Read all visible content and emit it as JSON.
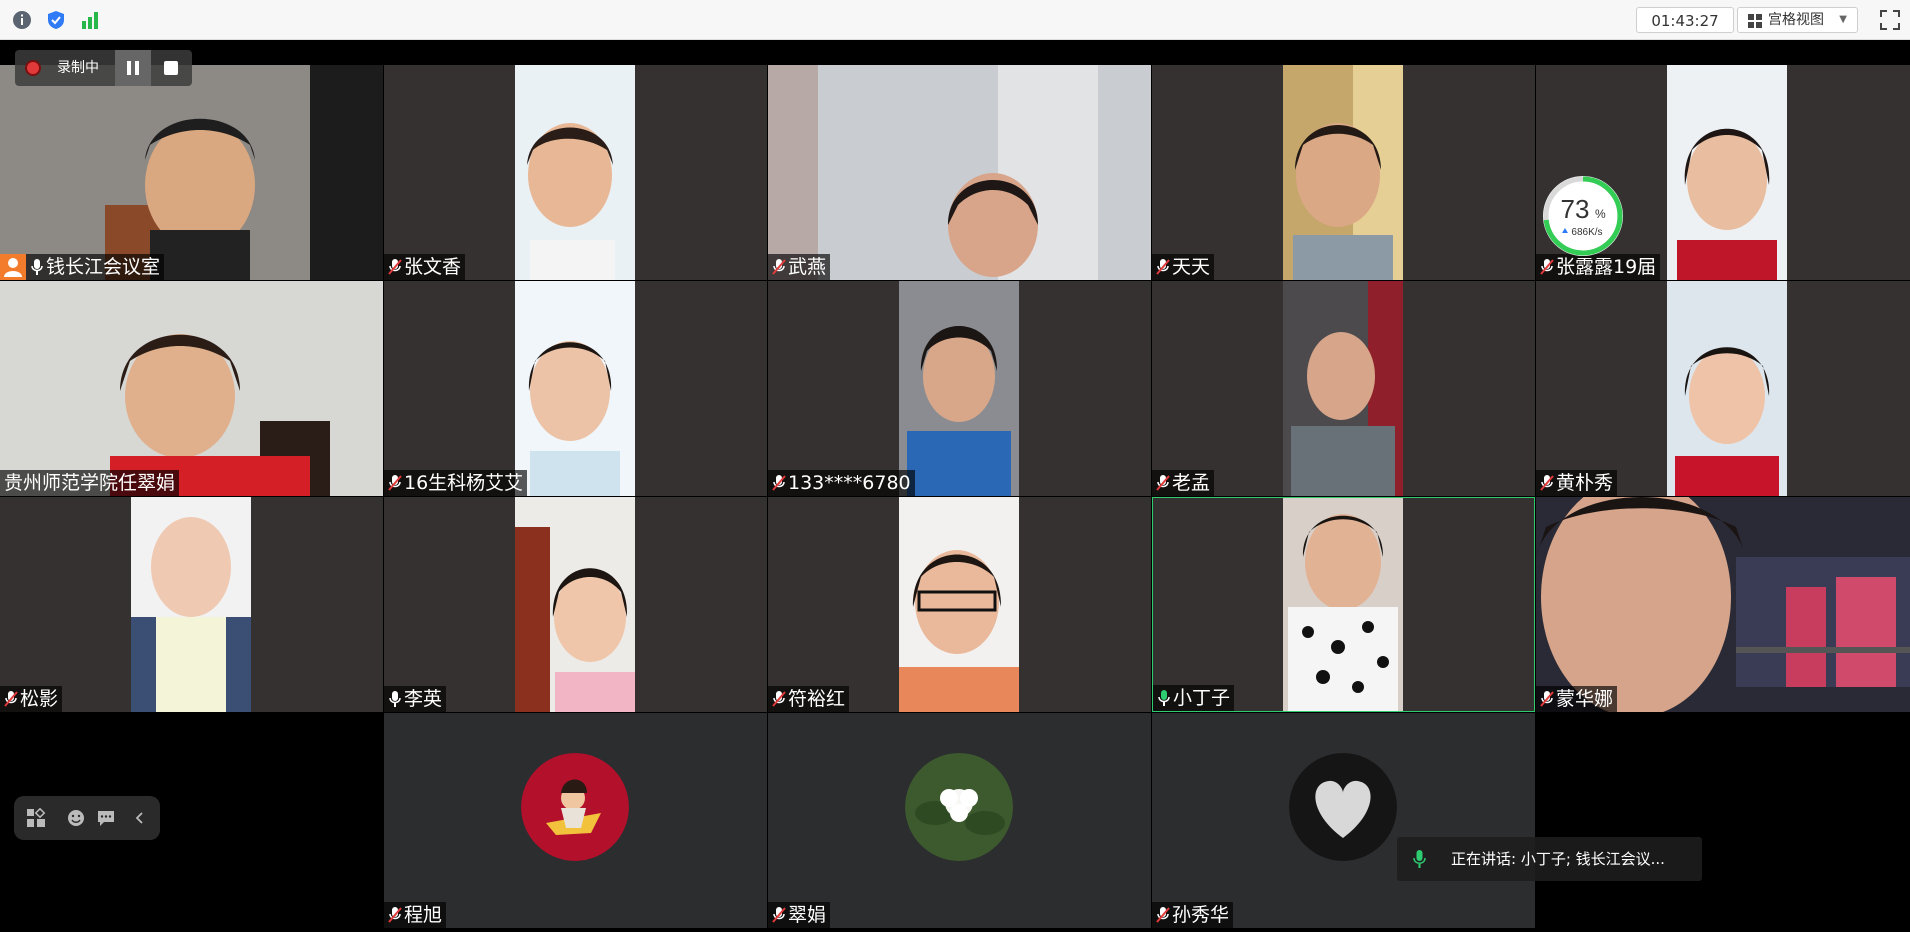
{
  "timer": "01:43:27",
  "view_mode": "宫格视图",
  "recording": {
    "label": "录制中"
  },
  "network": {
    "percent": "73",
    "unit": "%",
    "speed": "686K/s"
  },
  "speaking": "正在讲话: 小丁子; 钱长江会议...",
  "participants": [
    {
      "name": "钱长江会议室",
      "host": true,
      "mic": "on"
    },
    {
      "name": "张文香",
      "mic": "off"
    },
    {
      "name": "武燕",
      "mic": "off"
    },
    {
      "name": "天天",
      "mic": "off"
    },
    {
      "name": "张露露19届",
      "mic": "off"
    },
    {
      "name": "贵州师范学院任翠娟",
      "mic": "none"
    },
    {
      "name": "16生科杨艾艾",
      "mic": "off"
    },
    {
      "name": "133****6780",
      "mic": "off"
    },
    {
      "name": "老孟",
      "mic": "off"
    },
    {
      "name": "黄朴秀",
      "mic": "off"
    },
    {
      "name": "松影",
      "mic": "off"
    },
    {
      "name": "李英",
      "mic": "on"
    },
    {
      "name": "符裕红",
      "mic": "off"
    },
    {
      "name": "小丁子",
      "mic": "active"
    },
    {
      "name": "蒙华娜",
      "mic": "off"
    },
    {
      "name": "程旭",
      "mic": "off"
    },
    {
      "name": "翠娟",
      "mic": "off"
    },
    {
      "name": "孙秀华",
      "mic": "off"
    }
  ],
  "colors": {
    "active_border": "#2ecc71",
    "rec_red": "#e23a3a",
    "host_badge": "#f27b2c",
    "speed_ring": "#33cc55"
  }
}
